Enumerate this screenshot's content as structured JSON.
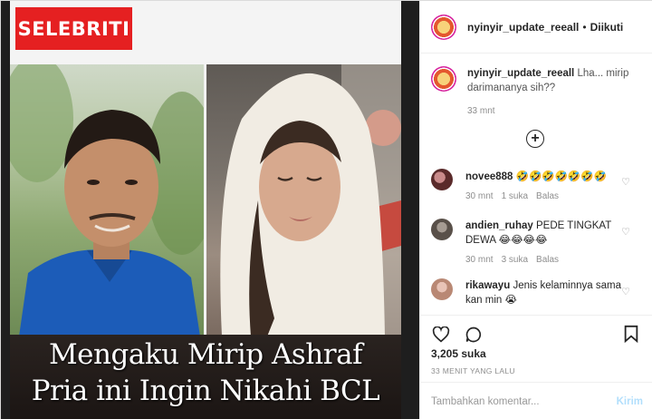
{
  "post": {
    "brand_label": "SELEBRITI",
    "caption_line_1": "Mengaku Mirip Ashraf",
    "caption_line_2": "Pria ini Ingin Nikahi BCL"
  },
  "header": {
    "username": "nyinyir_update_reeall",
    "separator": "•",
    "follow_status": "Diikuti"
  },
  "caption": {
    "username": "nyinyir_update_reeall",
    "text": "Lha... mirip darimananya sih??",
    "time": "33 mnt"
  },
  "load_more": {
    "symbol": "+"
  },
  "comments": [
    {
      "username": "novee888",
      "text": "🤣🤣🤣🤣🤣🤣🤣",
      "time": "30 mnt",
      "likes": "1 suka",
      "reply": "Balas"
    },
    {
      "username": "andien_ruhay",
      "text": "PEDE TINGKAT DEWA 😂😂😂😂",
      "time": "30 mnt",
      "likes": "3 suka",
      "reply": "Balas"
    },
    {
      "username": "rikawayu",
      "text": "Jenis kelaminnya sama kan min 😭",
      "time": "",
      "likes": "",
      "reply": ""
    }
  ],
  "actions": {
    "likes_count": "3,205 suka",
    "post_time": "33 MENIT YANG LALU"
  },
  "comment_box": {
    "placeholder": "Tambahkan komentar...",
    "send_label": "Kirim"
  },
  "icons": {
    "heart": "heart-icon",
    "comment": "comment-icon",
    "save": "bookmark-icon",
    "like_small": "heart-small-icon",
    "load_more": "plus-circle-icon"
  },
  "colors": {
    "brand_red": "#e52021",
    "text_dark": "#262626",
    "text_muted": "#8e8e8e",
    "send_disabled": "#b2dffc"
  }
}
